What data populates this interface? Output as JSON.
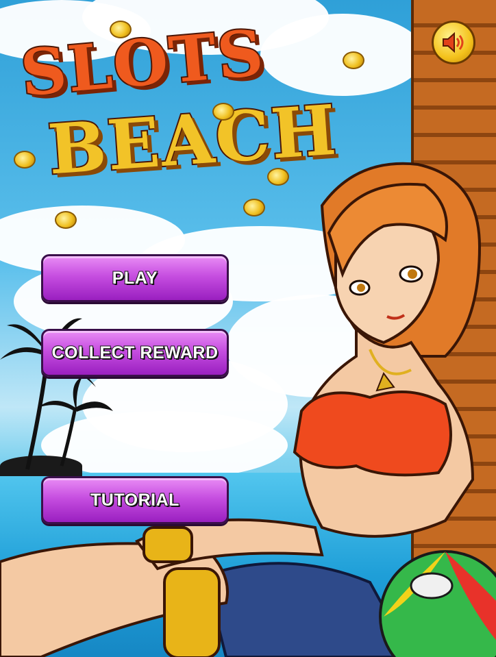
{
  "game": {
    "title_line1": "SLOTS",
    "title_line2": "BEACH"
  },
  "menu": {
    "play_label": "PLAY",
    "collect_reward_label": "COLLECT REWARD",
    "tutorial_label": "TUTORIAL"
  },
  "icons": {
    "sound": "speaker-icon"
  },
  "colors": {
    "button_top": "#e98cf5",
    "button_bottom": "#9a1fc0",
    "title_red": "#ef5a1e",
    "title_yellow": "#f2c328",
    "sky": "#2fa0d8",
    "trunk": "#c56a22"
  }
}
